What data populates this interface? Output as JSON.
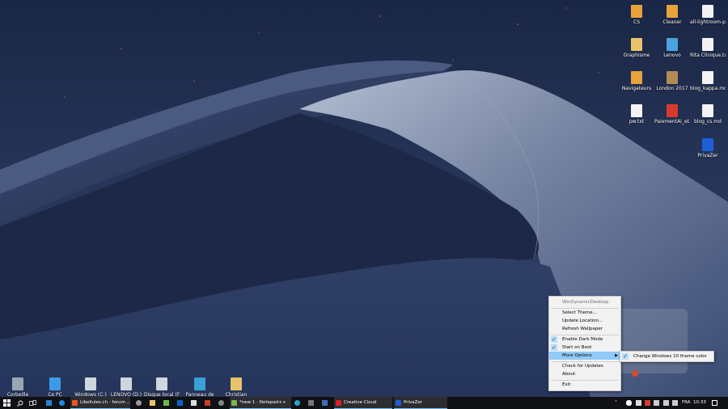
{
  "desktop_icons": [
    {
      "label": "CS",
      "color": "#e8a33b"
    },
    {
      "label": "Cleaner",
      "color": "#e8a33b"
    },
    {
      "label": "all-lightroom-p...",
      "color": "#f3f3f3"
    },
    {
      "label": "Graphisme",
      "color": "#e8c36b"
    },
    {
      "label": "Lenovo",
      "color": "#4aa3df"
    },
    {
      "label": "Rita Clinique.txt",
      "color": "#f3f3f3"
    },
    {
      "label": "Navigateurs",
      "color": "#e8a33b"
    },
    {
      "label": "London 2017",
      "color": "#b38b55"
    },
    {
      "label": "blog_kappa.md",
      "color": "#f3f3f3"
    },
    {
      "label": "pw.txt",
      "color": "#f3f3f3"
    },
    {
      "label": "PaiementAi_et...",
      "color": "#d83b2e"
    },
    {
      "label": "blog_cs.md",
      "color": "#f3f3f3"
    },
    {
      "label": "PrivaZer",
      "color": "#1d5fd8"
    }
  ],
  "bottom_icons": [
    {
      "label": "Corbeille",
      "color": "#9aa7b3"
    },
    {
      "label": "Ce PC",
      "color": "#3d9ae8"
    },
    {
      "label": "Windows (C:)",
      "color": "#cfd6de"
    },
    {
      "label": "LENOVO (D:)",
      "color": "#cfd6de"
    },
    {
      "label": "Disque local (F:)",
      "color": "#cfd6de"
    },
    {
      "label": "Panneau de",
      "color": "#3aa0d8"
    },
    {
      "label": "Christian",
      "color": "#e8c36b"
    }
  ],
  "context_menu": {
    "title": "WinDynamicDesktop",
    "items": {
      "select_theme": "Select Theme...",
      "update_location": "Update Location...",
      "refresh": "Refresh Wallpaper",
      "dark_mode": "Enable Dark Mode",
      "start_boot": "Start on Boot",
      "more_options": "More Options",
      "check_updates": "Check for Updates",
      "about": "About",
      "exit": "Exit"
    },
    "checked": {
      "dark_mode": true,
      "start_boot": true
    },
    "submenu": {
      "change_color": "Change Windows 10 theme color",
      "checked": true
    }
  },
  "taskbar": {
    "apps": [
      {
        "label": "Libellules.ch - forum ...",
        "color": "#e8562a",
        "active": true
      },
      {
        "label": "*new 1 - Notepad++",
        "color": "#7ab648",
        "active": true
      },
      {
        "label": "Creative Cloud",
        "color": "#da1f26",
        "active": true
      },
      {
        "label": "PrivaZer",
        "color": "#1d5fd8",
        "active": true
      }
    ],
    "language": "FRA",
    "time": "10:33"
  },
  "colors": {
    "taskbar": "#101114",
    "highlight": "#91c9f7",
    "accent": "#76b9ed"
  }
}
